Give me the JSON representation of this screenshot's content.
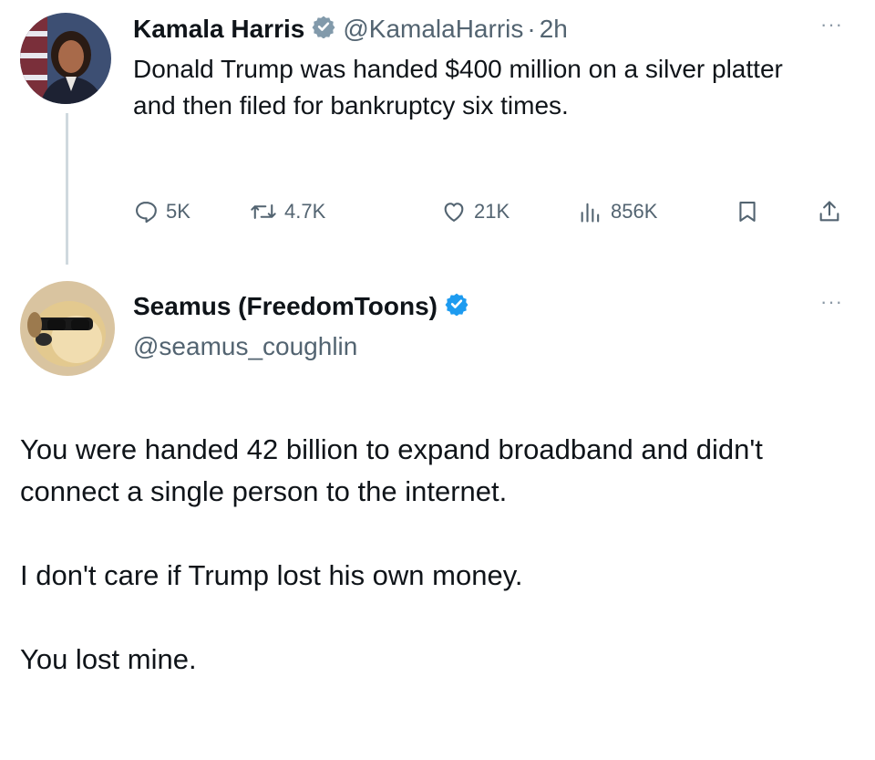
{
  "tweet": {
    "author_name": "Kamala Harris",
    "handle": "@KamalaHarris",
    "separator": "·",
    "time": "2h",
    "more_label": "···",
    "text": "Donald Trump was handed $400 million on a silver platter and then filed for bankruptcy six times.",
    "stats": {
      "replies": "5K",
      "reposts": "4.7K",
      "likes": "21K",
      "views": "856K"
    },
    "icons": [
      "reply-icon",
      "repost-icon",
      "like-icon",
      "views-icon",
      "bookmark-icon",
      "share-icon"
    ]
  },
  "reply": {
    "author_name": "Seamus (FreedomToons)",
    "handle": "@seamus_coughlin",
    "more_label": "···",
    "paragraphs": [
      "You were handed 42 billion to expand broadband and didn't connect a single person to the internet.",
      "I don't care if Trump lost his own money.",
      "You lost mine."
    ]
  },
  "colors": {
    "verified_gray": "#829aab",
    "verified_blue": "#1d9bf0",
    "secondary_text": "#536471",
    "thread_line": "#cfd9de"
  }
}
